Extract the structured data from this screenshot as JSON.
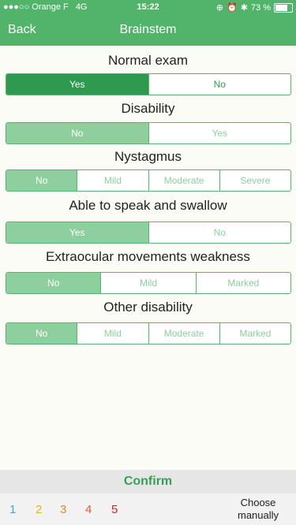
{
  "status": {
    "carrier": "●●●○○ Orange F",
    "network": "4G",
    "time": "15:22",
    "battery": "73 %",
    "battery_level": 0.73
  },
  "nav": {
    "back_label": "Back",
    "title": "Brainstem"
  },
  "sections": [
    {
      "title": "Normal exam",
      "options": [
        "Yes",
        "No"
      ],
      "selected": 0
    },
    {
      "title": "Disability",
      "options": [
        "No",
        "Yes"
      ],
      "selected": 0
    },
    {
      "title": "Nystagmus",
      "options": [
        "No",
        "Mild",
        "Moderate",
        "Severe"
      ],
      "selected": 0
    },
    {
      "title": "Able to speak and swallow",
      "options": [
        "Yes",
        "No"
      ],
      "selected": 0
    },
    {
      "title": "Extraocular movements weakness",
      "options": [
        "No",
        "Mild",
        "Marked"
      ],
      "selected": 0
    },
    {
      "title": "Other disability",
      "options": [
        "No",
        "Mild",
        "Moderate",
        "Marked"
      ],
      "selected": 0
    }
  ],
  "footer": {
    "confirm_label": "Confirm",
    "scores": [
      "1",
      "2",
      "3",
      "4",
      "5"
    ],
    "score_colors": [
      "#4aa3d8",
      "#e0b51a",
      "#e4872a",
      "#e05a3a",
      "#d9202a"
    ],
    "choose_label": "Choose manually"
  }
}
